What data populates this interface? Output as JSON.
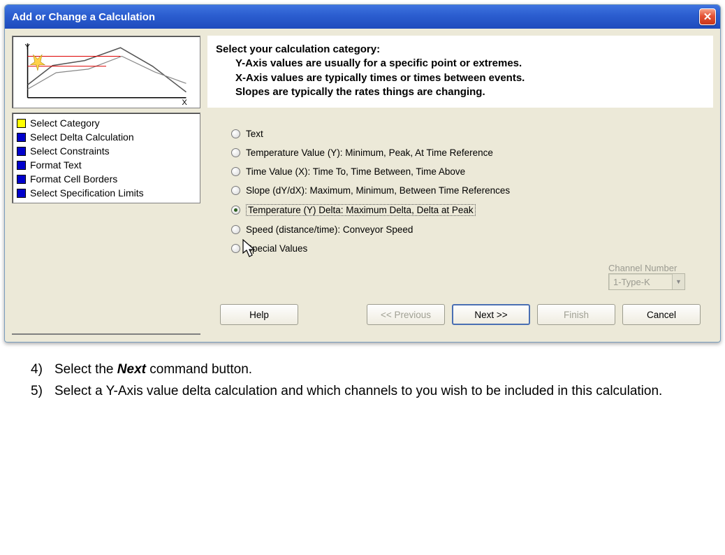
{
  "titlebar": {
    "title": "Add or Change a Calculation"
  },
  "steps": [
    {
      "color": "yellow",
      "label": "Select Category"
    },
    {
      "color": "blue",
      "label": "Select Delta Calculation"
    },
    {
      "color": "blue",
      "label": "Select Constraints"
    },
    {
      "color": "blue",
      "label": "Format Text"
    },
    {
      "color": "blue",
      "label": "Format Cell Borders"
    },
    {
      "color": "blue",
      "label": "Select Specification Limits"
    }
  ],
  "header": {
    "title": "Select your calculation category:",
    "line1": "Y-Axis values are usually for a specific point or extremes.",
    "line2": "X-Axis values are typically times or times between events.",
    "line3": "Slopes are typically the rates things are changing."
  },
  "radios": [
    {
      "label": "Text",
      "selected": false
    },
    {
      "label": "Temperature Value (Y):  Minimum, Peak, At Time Reference",
      "selected": false
    },
    {
      "label": "Time Value (X):  Time To, Time Between, Time Above",
      "selected": false
    },
    {
      "label": "Slope (dY/dX):  Maximum, Minimum, Between Time References",
      "selected": false
    },
    {
      "label": "Temperature (Y) Delta:  Maximum Delta, Delta at Peak",
      "selected": true
    },
    {
      "label": "Speed (distance/time): Conveyor Speed",
      "selected": false
    },
    {
      "label": "Special  Values",
      "selected": false
    }
  ],
  "channel": {
    "label": "Channel Number",
    "value": "1-Type-K"
  },
  "buttons": {
    "help": "Help",
    "prev": "<< Previous",
    "next": "Next >>",
    "finish": "Finish",
    "cancel": "Cancel"
  },
  "instructions": {
    "item4_pre": "Select the ",
    "item4_bold": "Next",
    "item4_post": " command button.",
    "item5": "Select a Y-Axis value delta calculation and which channels to you wish to be included in this calculation."
  }
}
